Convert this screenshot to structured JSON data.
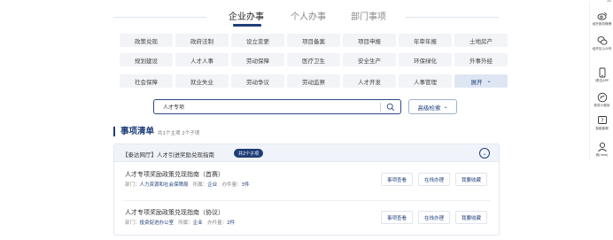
{
  "top_tabs": [
    "企业办事",
    "个人办事",
    "部门事项"
  ],
  "categories": [
    [
      "政策兑现",
      "政府法制",
      "设立变更",
      "项目备案",
      "项目申报",
      "年审年报",
      "土地房产"
    ],
    [
      "规划建设",
      "人才人事",
      "劳动保障",
      "医疗卫生",
      "安全生产",
      "环保绿化",
      "外事外经"
    ],
    [
      "社会保障",
      "就业失业",
      "劳动争议",
      "劳动监察",
      "人才开发",
      "人事管理",
      "展开"
    ]
  ],
  "search": {
    "value": "人才专项"
  },
  "advanced_search": "高级检索",
  "list": {
    "title": "事项清单",
    "count_text": "共1个主项  2个子项"
  },
  "group": {
    "title": "【泰达网厅】人才引进奖励兑现指南",
    "badge": "共2个子项",
    "items": [
      {
        "name": "人才专项奖励政策兑现指南（首赛）",
        "dept_label": "部门：",
        "dept": "人力资源和社会保障局",
        "type_label": "所属：",
        "type": "企业",
        "count_label": "办件量：",
        "count": "3件",
        "buttons": [
          "事项查看",
          "在线办理",
          "我要收藏"
        ]
      },
      {
        "name": "人才专项奖励政策兑现指南（协议）",
        "dept_label": "部门：",
        "dept": "投资促进办公室",
        "type_label": "所属：",
        "type": "企业",
        "count_label": "办件量：",
        "count": "2件",
        "buttons": [
          "事项查看",
          "在线办理",
          "我要收藏"
        ]
      }
    ]
  },
  "sidebar": [
    {
      "icon": "weibo-icon",
      "label": "经开政务微博"
    },
    {
      "icon": "wechat-icon",
      "label": "经开区公众号"
    },
    {
      "icon": "mobile-icon",
      "label": "i泰达APP"
    },
    {
      "icon": "miniprogram-icon",
      "label": "政务小程序"
    },
    {
      "icon": "help-icon",
      "label": "智能客服"
    },
    {
      "icon": "user-icon",
      "label": "我(new)"
    }
  ]
}
